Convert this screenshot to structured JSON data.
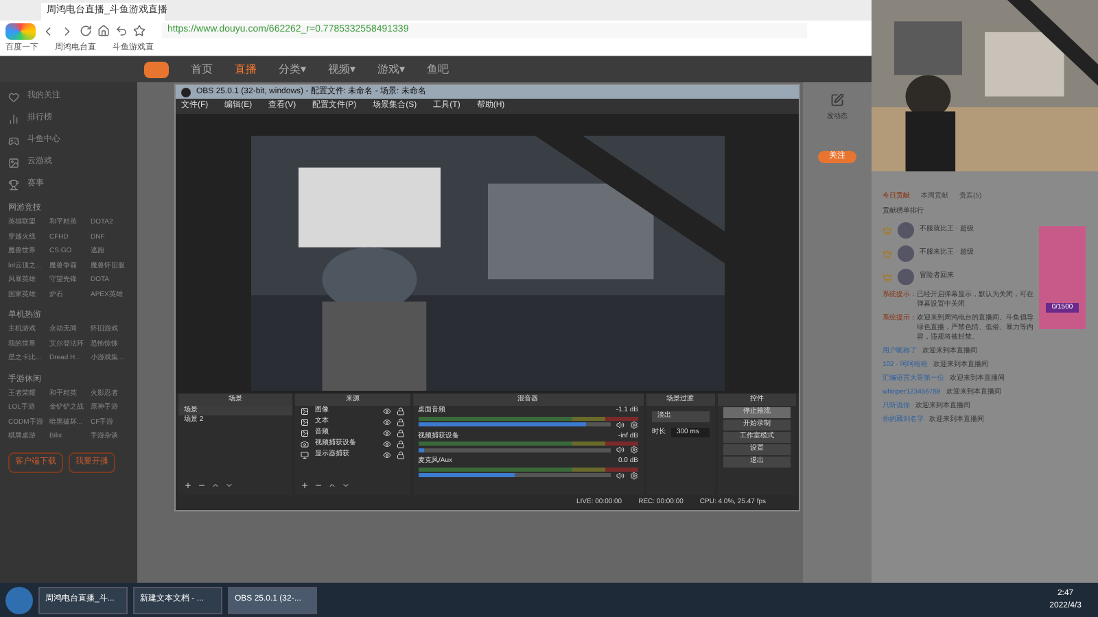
{
  "browser": {
    "tab_title": "周鸿电台直播_斗鱼游戏直播",
    "address": "https://www.douyu.com/662262_r=0.7785332558491339",
    "bookmarks": [
      "百度一下",
      "周鸿电台直",
      "斗鱼游戏直"
    ]
  },
  "site_nav": [
    {
      "label": "首页",
      "selected": false
    },
    {
      "label": "直播",
      "selected": true
    },
    {
      "label": "分类▾",
      "selected": false
    },
    {
      "label": "视频▾",
      "selected": false
    },
    {
      "label": "游戏▾",
      "selected": false
    },
    {
      "label": "鱼吧",
      "selected": false
    }
  ],
  "sidebar": {
    "items": [
      "我的关注",
      "排行榜",
      "斗鱼中心",
      "云游戏",
      "赛事"
    ],
    "sections": [
      {
        "title": "网游竞技",
        "items": [
          "英雄联盟",
          "和平精英",
          "DOTA2",
          "穿越火线",
          "CFHD",
          "DNF",
          "魔兽世界",
          "CS:GO",
          "逃跑",
          "lol云顶之...",
          "魔兽争霸",
          "魔兽怀旧服",
          "风暴英雄",
          "守望先锋",
          "DOTA",
          "国家英雄",
          "炉石",
          "APEX英雄"
        ]
      },
      {
        "title": "单机热游",
        "items": [
          "主机游戏",
          "永劫无间",
          "怀旧游戏",
          "我的世界",
          "艾尔登法环",
          "恐怖惊悚",
          "星之卡比...",
          "Dread H...",
          "小游戏集..."
        ]
      },
      {
        "title": "手游休闲",
        "items": [
          "王者荣耀",
          "和平精英",
          "火影忍者",
          "LOL手游",
          "金铲铲之战",
          "原神手游",
          "CODM手游",
          "暗黑破坏...",
          "CF手游",
          "棋牌桌游",
          "Bilix",
          "手游杂谈"
        ]
      }
    ],
    "buttons": [
      "客户端下载",
      "我要开播"
    ]
  },
  "obs": {
    "title": "OBS 25.0.1 (32-bit, windows) - 配置文件: 未命名 - 场景: 未命名",
    "menu": [
      "文件(F)",
      "编辑(E)",
      "查看(V)",
      "配置文件(P)",
      "场景集合(S)",
      "工具(T)",
      "帮助(H)"
    ],
    "docks": [
      "场景",
      "来源",
      "混音器",
      "场景过渡",
      "控件"
    ],
    "scenes": [
      {
        "name": "场景",
        "selected": true
      },
      {
        "name": "场景 2",
        "selected": false
      }
    ],
    "sources": [
      {
        "name": "图像"
      },
      {
        "name": "文本"
      },
      {
        "name": "音频"
      },
      {
        "name": "视频捕获设备",
        "kind": "camera"
      },
      {
        "name": "显示器捕获",
        "kind": "monitor"
      }
    ],
    "mixer": [
      {
        "name": "桌面音频",
        "reading": "-1.1 dB",
        "level": 0.87
      },
      {
        "name": "视频捕获设备",
        "reading": "-inf dB",
        "level": 0.03
      },
      {
        "name": "麦克风/Aux",
        "reading": "0.0 dB",
        "level": 0.5
      }
    ],
    "transition": {
      "type": "淡出",
      "duration_label": "时长",
      "duration": "300 ms"
    },
    "controls": [
      {
        "label": "停止推流",
        "selected": true
      },
      {
        "label": "开始录制",
        "selected": false
      },
      {
        "label": "工作室模式",
        "selected": false
      },
      {
        "label": "设置",
        "selected": false
      },
      {
        "label": "退出",
        "selected": false
      }
    ],
    "status": [
      "LIVE: 00:00:00",
      "REC: 00:00:00",
      "CPU: 4.0%, 25.47 fps"
    ]
  },
  "room": {
    "post_label": "发动态",
    "follow": "关注",
    "rank_tabs": [
      {
        "label": "今日贡献",
        "selected": true
      },
      {
        "label": "本周贡献",
        "selected": false
      },
      {
        "label": "贵宾(5)",
        "selected": false
      }
    ],
    "rank_title": "贡献榜单排行",
    "ranks": [
      {
        "name": "不服就比王 · 超级"
      },
      {
        "name": "不服来比王 · 超级"
      },
      {
        "name": "冒险者回来"
      }
    ],
    "promo": "0/1500",
    "messages": [
      {
        "kind": "system",
        "tag": "系统提示：",
        "text": "已经开启弹幕显示，默认为关闭，可在弹幕设置中关闭"
      },
      {
        "kind": "system",
        "tag": "系统提示：",
        "text": "欢迎来到周鸿电台的直播间。斗鱼倡导绿色直播，严禁色情、低俗、暴力等内容，违规将被封禁。"
      },
      {
        "kind": "user",
        "user": "用户昵称了",
        "text": "欢迎来到本直播间"
      },
      {
        "kind": "user",
        "user": "102 · 呵呵哈哈",
        "text": "欢迎来到本直播间"
      },
      {
        "kind": "user",
        "user": "汇编语言大哥第一位",
        "text": "欢迎来到本直播间"
      },
      {
        "kind": "user",
        "user": "whisper123456789",
        "text": "欢迎来到本直播间"
      },
      {
        "kind": "user",
        "user": "只听说你",
        "text": "欢迎来到本直播间"
      },
      {
        "kind": "user",
        "user": "你的藏剑名字",
        "text": "欢迎来到本直播间"
      }
    ]
  },
  "taskbar": {
    "apps": [
      {
        "label": "周鸿电台直播_斗...",
        "selected": false
      },
      {
        "label": "新建文本文档 - ...",
        "selected": false
      },
      {
        "label": "OBS 25.0.1 (32-...",
        "selected": true
      }
    ],
    "time": "2:47",
    "date": "2022/4/3"
  }
}
